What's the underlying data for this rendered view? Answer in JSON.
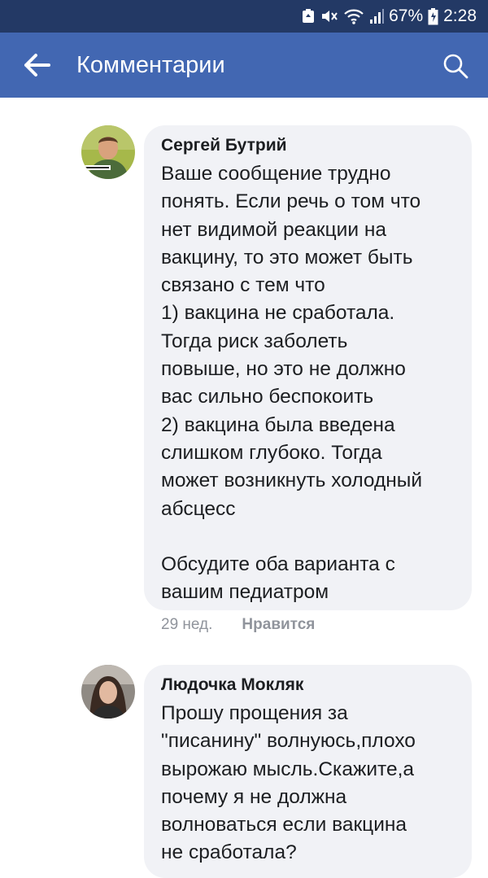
{
  "status_bar": {
    "battery": "67%",
    "time": "2:28"
  },
  "header": {
    "title": "Комментарии"
  },
  "comments": [
    {
      "author": "Сергей Бутрий",
      "lines": [
        "Ваше сообщение трудно",
        "понять. Если речь о том что",
        "нет видимой реакции на",
        "вакцину, то это может быть",
        "связано с тем что",
        "1) вакцина не сработала.",
        "Тогда риск заболеть",
        "повыше, но это не должно",
        "вас сильно беспокоить",
        "2) вакцина была введена",
        "слишком глубоко. Тогда",
        "может возникнуть холодный",
        "абсцесс",
        "",
        "Обсудите оба варианта с",
        "вашим педиатром"
      ],
      "time": "29 нед.",
      "like_label": "Нравится"
    },
    {
      "author": "Людочка Мокляк",
      "lines": [
        "Прошу прощения за",
        "\"писанину\" волнуюсь,плохо",
        "вырожаю мысль.Скажите,а",
        "почему я не должна",
        "волноваться если вакцина",
        "не сработала?"
      ]
    }
  ]
}
